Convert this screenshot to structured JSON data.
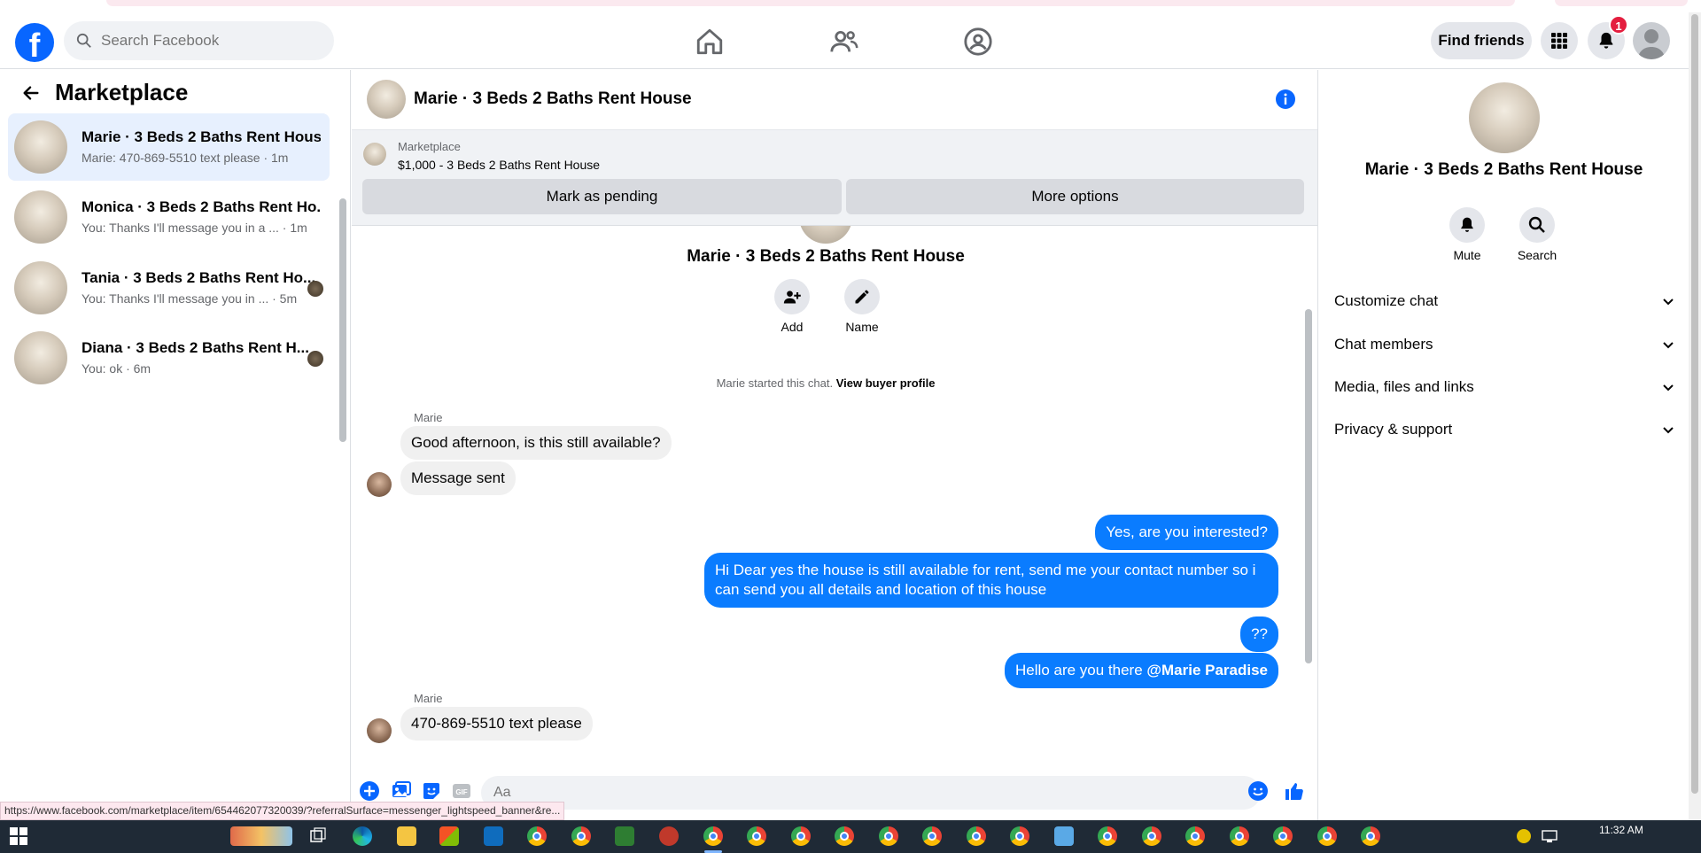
{
  "nav": {
    "search_placeholder": "Search Facebook",
    "find_friends": "Find friends",
    "notification_count": "1"
  },
  "left": {
    "title": "Marketplace",
    "conversations": [
      {
        "name": "Marie · 3 Beds 2 Baths Rent House",
        "preview": "Marie: 470-869-5510 text please · 1m"
      },
      {
        "name": "Monica · 3 Beds 2 Baths Rent Ho...",
        "preview": "You: Thanks I'll message you in a ... · 1m"
      },
      {
        "name": "Tania · 3 Beds 2 Baths Rent Ho...",
        "preview": "You: Thanks I'll message you in ... · 5m"
      },
      {
        "name": "Diana · 3 Beds 2 Baths Rent H...",
        "preview": "You: ok · 6m"
      }
    ]
  },
  "chat": {
    "title": "Marie · 3 Beds 2 Baths Rent House",
    "banner_label": "Marketplace",
    "banner_listing": "$1,000 - 3 Beds 2 Baths Rent House",
    "mark_pending": "Mark as pending",
    "more_options": "More options",
    "intro_title": "Marie · 3 Beds 2 Baths Rent House",
    "add_label": "Add",
    "name_label": "Name",
    "started_text": "Marie started this chat.",
    "view_profile": "View buyer profile",
    "sender1": "Marie",
    "msg1": "Good afternoon, is this still available?",
    "msg2": "Message sent",
    "out1": "Yes, are you interested?",
    "out2": "Hi Dear yes the house is still available for rent, send me your contact number so i can send you all details and location of this house",
    "out3": "??",
    "out4_text": "Hello are you there",
    "out4_mention": "@Marie Paradise",
    "sender2": "Marie",
    "msg3": "470-869-5510  text please",
    "composer_placeholder": "Aa"
  },
  "right": {
    "name": "Marie · 3 Beds 2 Baths Rent House",
    "mute": "Mute",
    "search": "Search",
    "sections": [
      "Customize chat",
      "Chat members",
      "Media, files and links",
      "Privacy & support"
    ]
  },
  "status_url": "https://www.facebook.com/marketplace/item/654462077320039/?referralSurface=messenger_lightspeed_banner&re...",
  "taskbar": {
    "time": "11:32 AM"
  },
  "colors": {
    "brand": "#0866ff",
    "bubble_out": "#0a7cff",
    "badge": "#e41e3f"
  }
}
